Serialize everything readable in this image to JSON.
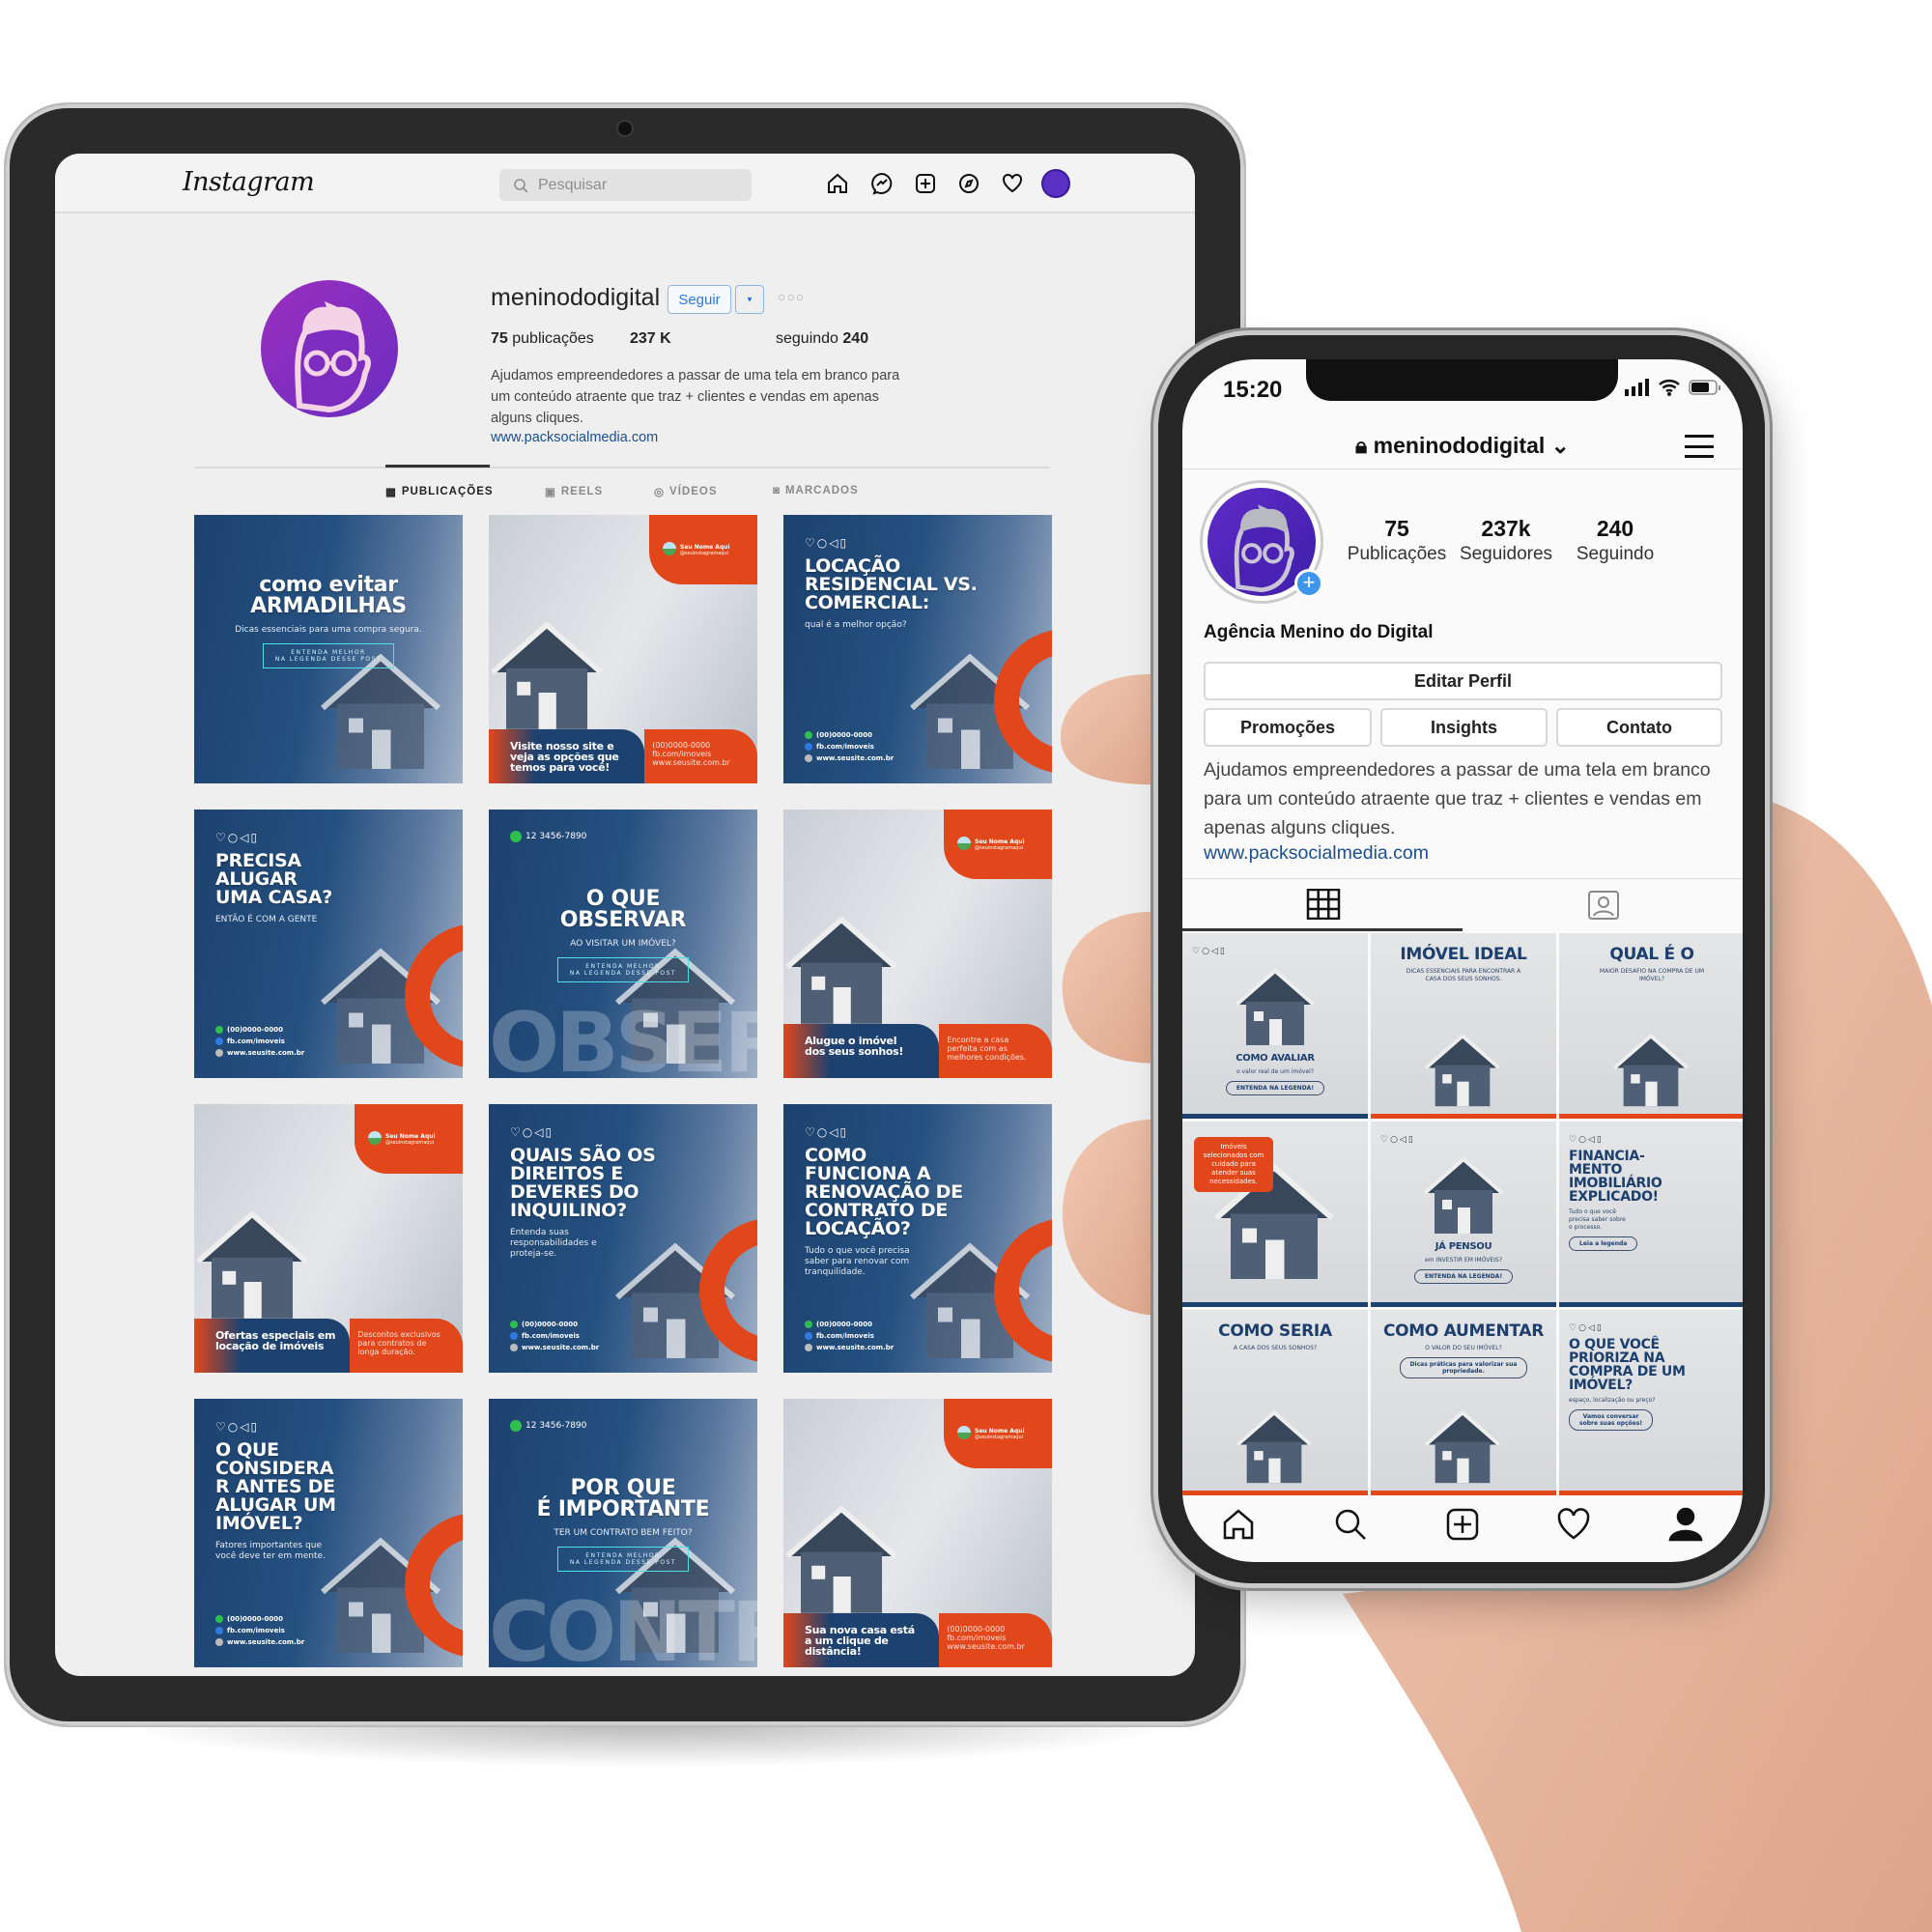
{
  "colors": {
    "brand_blue": "#1d426f",
    "brand_orange": "#e2461b",
    "link": "#1b4f8d",
    "avatar_purple": "#6a2dc0"
  },
  "shared": {
    "badge": {
      "name": "Seu Nome Aqui",
      "handle": "@seuinstagramaqui"
    },
    "contacts": [
      "(00)0000-0000",
      "fb.com/imoveis",
      "www.seusite.com.br"
    ],
    "post_icons": "♡○◁▯",
    "whatsapp": "12 3456-7890"
  },
  "tablet": {
    "header": {
      "logo": "Instagram",
      "search_placeholder": "Pesquisar",
      "icons": [
        "home-icon",
        "messenger-icon",
        "new-post-icon",
        "explore-icon",
        "heart-icon",
        "profile-avatar-icon"
      ]
    },
    "profile": {
      "username": "meninododigital",
      "follow_label": "Seguir",
      "dropdown_label": "▾",
      "more_label": "○○○",
      "posts_count": "75",
      "posts_label": "publicações",
      "followers": "237 K",
      "following_label": "seguindo",
      "following_count": "240",
      "bio": "Ajudamos empreendedores a passar de uma tela em branco para um conteúdo atraente que traz + clientes e vendas em apenas alguns cliques.",
      "link": "www.packsocialmedia.com"
    },
    "tabs": [
      {
        "label": "PUBLICAÇÕES",
        "icon": "grid-icon",
        "active": true
      },
      {
        "label": "REELS",
        "icon": "reels-icon"
      },
      {
        "label": "VÍDEOS",
        "icon": "video-icon"
      },
      {
        "label": "MARCADOS",
        "icon": "tagged-icon"
      }
    ],
    "posts": [
      {
        "variant": "blue",
        "headline": "como evitar\nARMADILHAS",
        "center": true,
        "sub": "Dicas essenciais para uma compra segura.",
        "cta": "ENTENDA MELHOR\nNA LEGENDA DESSE POST"
      },
      {
        "variant": "light",
        "badge": true,
        "footer_title": "Visite nosso site e\nveja as opções que\ntemos para você!",
        "footer_contacts": true
      },
      {
        "variant": "blue",
        "icons": true,
        "headline": "LOCAÇÃO\nRESIDENCIAL VS.\nCOMERCIAL:",
        "sub": "qual é a melhor opção?",
        "contacts": true,
        "arc": true
      },
      {
        "variant": "blue",
        "icons": true,
        "headline": "PRECISA\nALUGAR\nUMA CASA?",
        "sub": "ENTÃO É COM A GENTE",
        "contacts": true,
        "arc": true
      },
      {
        "variant": "blue",
        "whatsapp": true,
        "headline": "O QUE\nOBSERVAR",
        "center": true,
        "sub": "AO VISITAR UM IMÓVEL?",
        "cta": "ENTENDA MELHOR\nNA LEGENDA DESSE POST",
        "watermark": "OBSER"
      },
      {
        "variant": "light",
        "badge": true,
        "footer_title": "Alugue o imóvel\ndos seus sonhos!",
        "footer_text": "Encontre a casa\nperfeita com as\nmelhores condições."
      },
      {
        "variant": "light",
        "badge": true,
        "footer_title": "Ofertas especiais em\nlocação de imóveis",
        "footer_text": "Descontos exclusivos\npara contratos de\nlonga duração."
      },
      {
        "variant": "blue",
        "icons": true,
        "headline": "QUAIS SÃO OS\nDIREITOS E\nDEVERES DO\nINQUILINO?",
        "sub": "Entenda suas\nresponsabilidades e\nproteja-se.",
        "contacts": true,
        "arc": true
      },
      {
        "variant": "blue",
        "icons": true,
        "headline": "COMO\nFUNCIONA A\nRENOVAÇÃO DE\nCONTRATO DE\nLOCAÇÃO?",
        "sub": "Tudo o que você precisa\nsaber para renovar com\ntranquilidade.",
        "contacts": true,
        "arc": true
      },
      {
        "variant": "blue",
        "icons": true,
        "headline": "O QUE\nCONSIDERA\nR ANTES DE\nALUGAR UM\nIMÓVEL?",
        "sub": "Fatores importantes que\nvocê deve ter em mente.",
        "contacts": true,
        "arc": true
      },
      {
        "variant": "blue",
        "whatsapp": true,
        "headline": "POR QUE\nÉ IMPORTANTE",
        "center": true,
        "sub": "TER UM CONTRATO BEM FEITO?",
        "cta": "ENTENDA MELHOR\nNA LEGENDA DESSE POST",
        "watermark": "CONTR"
      },
      {
        "variant": "light",
        "badge": true,
        "footer_title": "Sua nova casa está\na um clique de\ndistância!",
        "footer_contacts": true
      }
    ]
  },
  "phone": {
    "status": {
      "time": "15:20"
    },
    "header": {
      "username": "meninododigital"
    },
    "stats": [
      {
        "value": "75",
        "label": "Publicações"
      },
      {
        "value": "237k",
        "label": "Seguidores"
      },
      {
        "value": "240",
        "label": "Seguindo"
      }
    ],
    "name": "Agência Menino do Digital",
    "buttons": {
      "edit": "Editar Perfil",
      "promos": "Promoções",
      "insights": "Insights",
      "contact": "Contato"
    },
    "bio": "Ajudamos empreendedores a passar de uma tela em branco para um conteúdo atraente que traz + clientes e vendas em apenas alguns cliques.",
    "link": "www.packsocialmedia.com",
    "tabs": [
      "grid-icon",
      "tagged-icon"
    ],
    "nav": [
      "home-icon",
      "search-icon",
      "new-post-icon",
      "heart-icon",
      "profile-icon"
    ],
    "posts": [
      {
        "headline": "COMO AVALIAR",
        "sub": "o valor real de um imóvel?",
        "cta": "ENTENDA NA LEGENDA!",
        "icons": true,
        "low": true,
        "bar": "blue"
      },
      {
        "headline": "IMÓVEL IDEAL",
        "sub": "DICAS ESSENCIAIS PARA ENCONTRAR A\nCASA DOS SEUS SONHOS.",
        "bar": "orange"
      },
      {
        "headline": "QUAL É O",
        "sub": "MAIOR DESAFIO NA COMPRA DE UM\nIMÓVEL?",
        "bar": "orange"
      },
      {
        "pill": "Imóveis\nselecionados com\ncuidado para\natender suas\nnecessidades.",
        "bar": "blue"
      },
      {
        "headline": "JÁ PENSOU",
        "sub": "em INVESTIR EM IMÓVEIS?",
        "cta": "ENTENDA NA LEGENDA!",
        "icons": true,
        "low": true,
        "bar": "blue"
      },
      {
        "headline": "FINANCIA-\nMENTO\nIMOBILIÁRIO\nEXPLICADO!",
        "sub": "Tudo o que você\nprecisa saber sobre\no processo.",
        "cta": "Leia a legenda",
        "icons": true,
        "left": true,
        "bar": "blue"
      },
      {
        "headline": "COMO SERIA",
        "sub": "A CASA DOS SEUS SONHOS?",
        "bar": "orange"
      },
      {
        "headline": "COMO AUMENTAR",
        "sub": "O VALOR DO SEU IMÓVEL?",
        "cta": "Dicas práticas para valorizar sua\npropriedade.",
        "bar": "orange"
      },
      {
        "headline": "O QUE VOCÊ\nPRIORIZA NA\nCOMPRA DE UM\nIMÓVEL?",
        "sub": "espaço, localização ou preço?",
        "cta": "Vamos conversar\nsobre suas opções!",
        "icons": true,
        "left": true,
        "bar": "orange"
      }
    ]
  }
}
